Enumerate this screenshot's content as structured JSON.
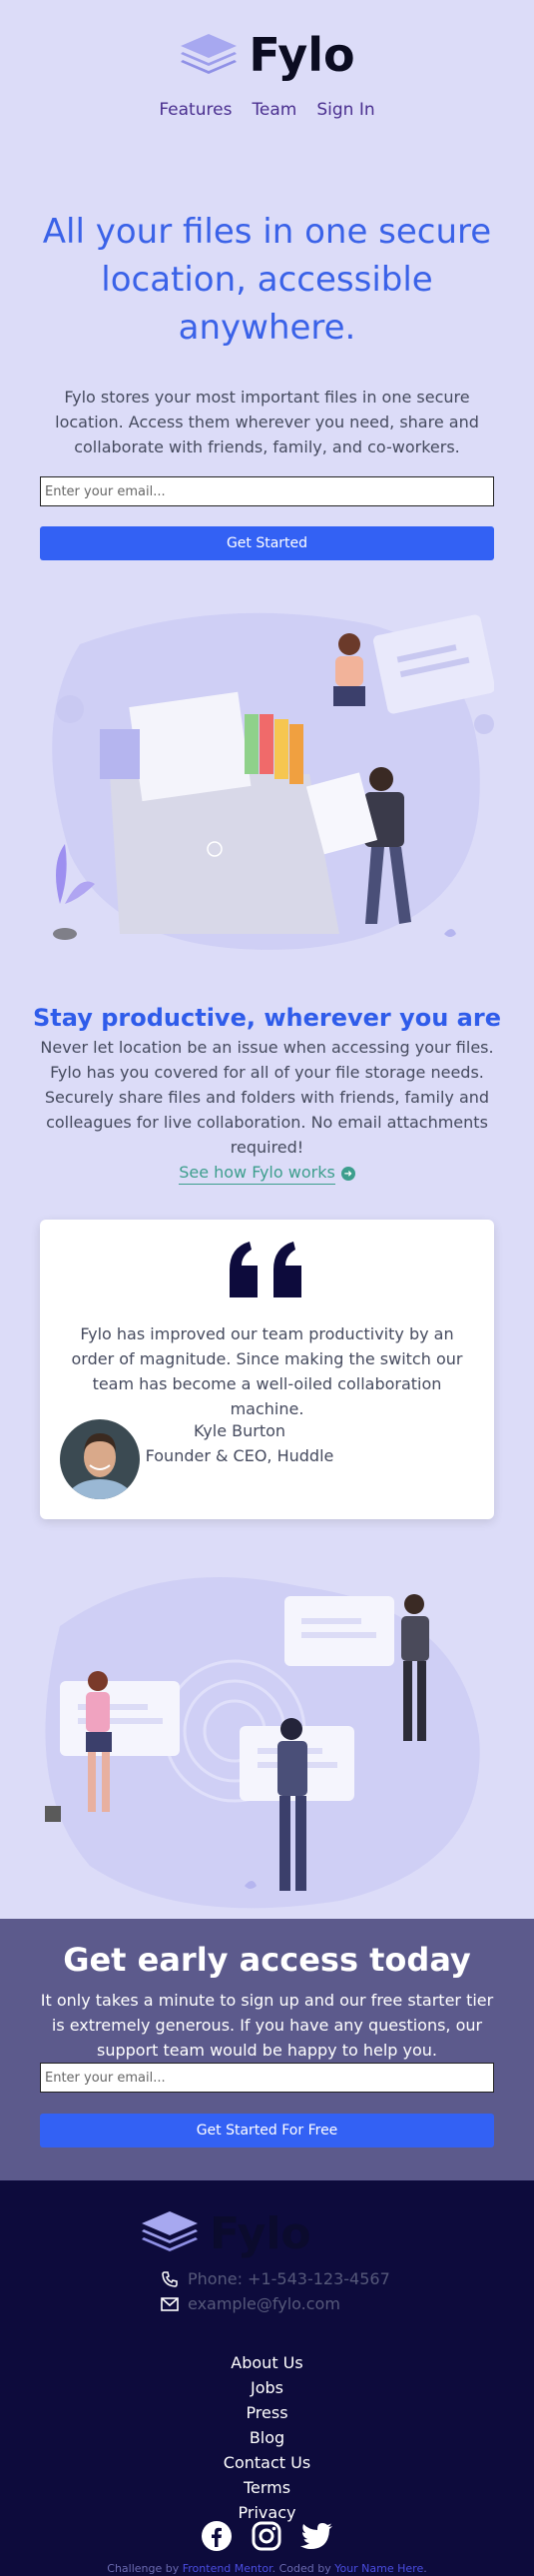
{
  "brand": {
    "name": "Fylo"
  },
  "nav": [
    {
      "label": "Features"
    },
    {
      "label": "Team"
    },
    {
      "label": "Sign In"
    }
  ],
  "hero": {
    "title": "All your files in one secure location, accessible anywhere.",
    "subtitle": "Fylo stores your most important files in one secure location. Access them wherever you need, share and collaborate with friends, family, and co-workers.",
    "email_placeholder": "Enter your email...",
    "cta_label": "Get Started"
  },
  "productive": {
    "title": "Stay productive, wherever you are",
    "text": "Never let location be an issue when accessing your files. Fylo has you covered for all of your file storage needs. Securely share files and folders with friends, family and colleagues for live collaboration. No email attachments required!",
    "link_label": "See how Fylo works"
  },
  "testimonial": {
    "quote": "Fylo has improved our team productivity by an order of magnitude. Since making the switch our team has become a well-oiled collaboration machine.",
    "name": "Kyle Burton",
    "role": "Founder & CEO, Huddle"
  },
  "early_access": {
    "title": "Get early access today",
    "text": "It only takes a minute to sign up and our free starter tier is extremely generous. If you have any questions, our support team would be happy to help you.",
    "email_placeholder": "Enter your email...",
    "cta_label": "Get Started For Free"
  },
  "footer": {
    "phone": "Phone: +1-543-123-4567",
    "email": "example@fylo.com",
    "links": [
      "About Us",
      "Jobs",
      "Press",
      "Blog",
      "Contact Us",
      "Terms",
      "Privacy"
    ],
    "socials": [
      "facebook-icon",
      "instagram-icon",
      "twitter-icon"
    ],
    "attribution": {
      "prefix": "Challenge by ",
      "fm": "Frontend Mentor",
      "middle": ". Coded by ",
      "author": "Your Name Here",
      "suffix": "."
    }
  },
  "colors": {
    "background": "#dcdcf8",
    "accent": "#3361f4",
    "heading": "#3a62e8",
    "link": "#3d9e8d",
    "early_bg": "#5c5a8c",
    "footer_bg": "#0d0b3c"
  }
}
